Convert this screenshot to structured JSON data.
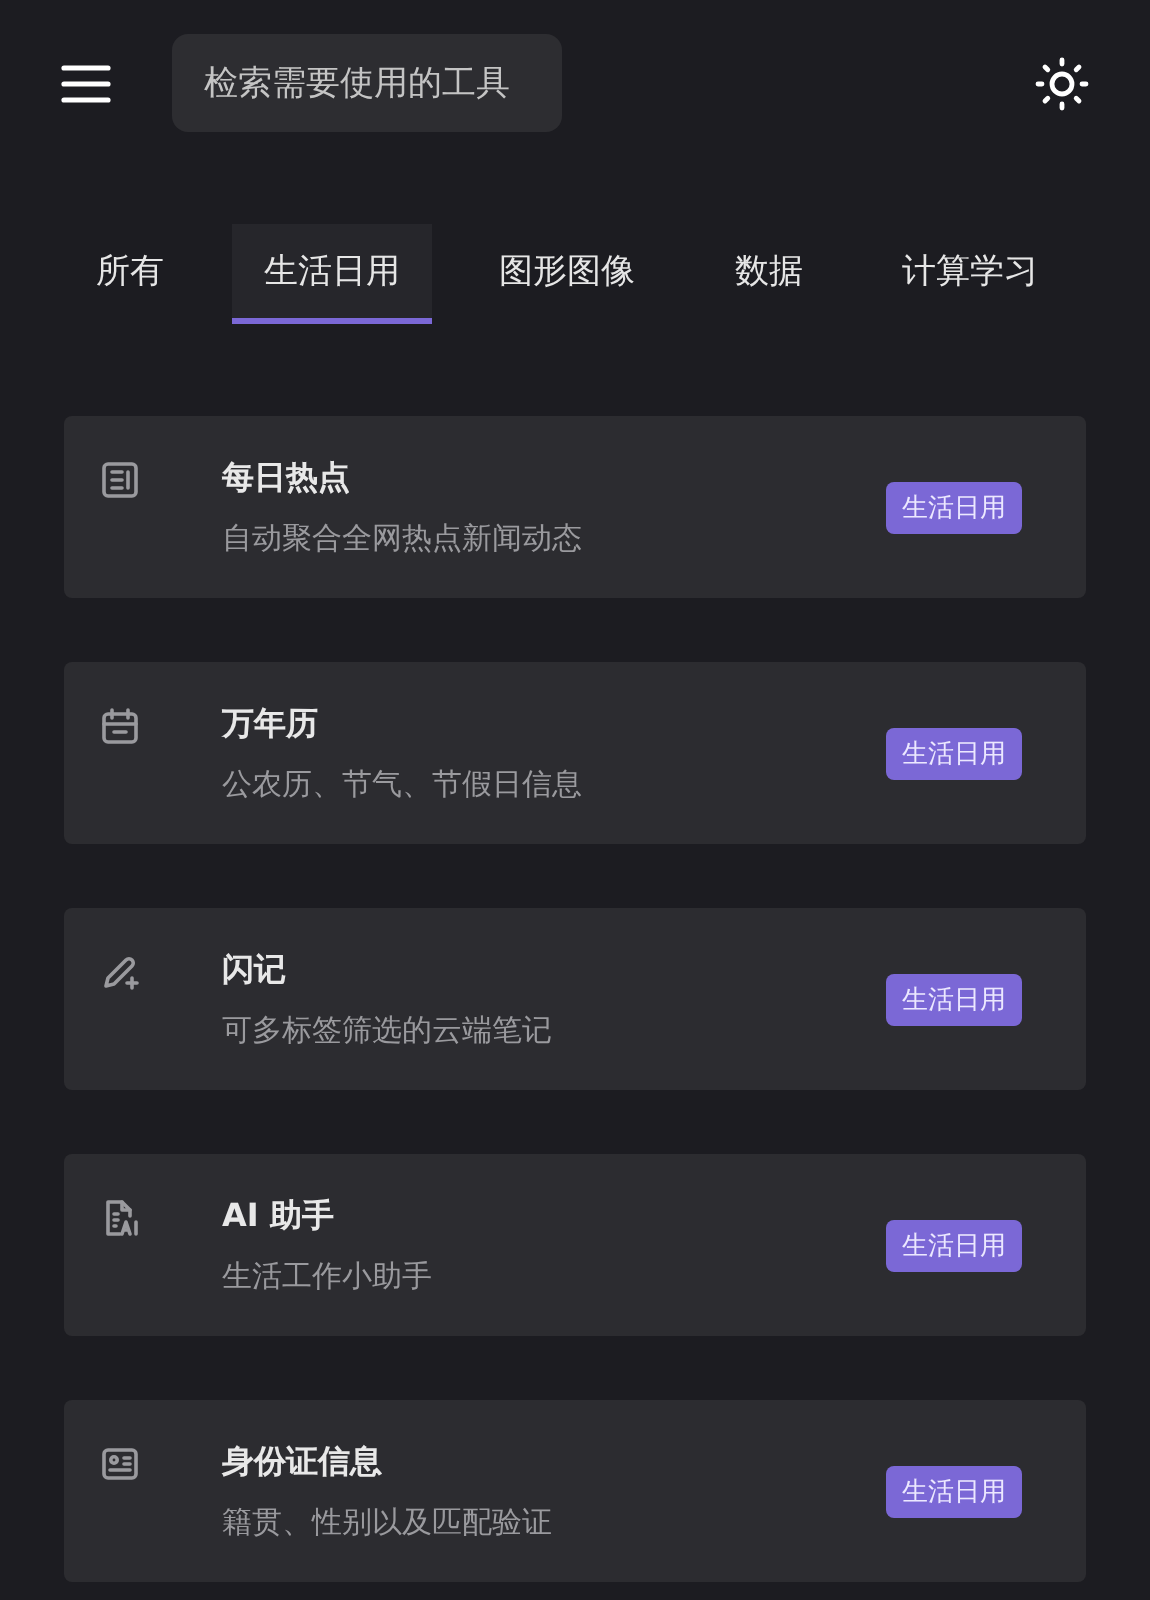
{
  "header": {
    "search": {
      "placeholder": "检索需要使用的工具"
    }
  },
  "tabs": [
    {
      "label": "所有",
      "selected": false
    },
    {
      "label": "生活日用",
      "selected": true
    },
    {
      "label": "图形图像",
      "selected": false
    },
    {
      "label": "数据",
      "selected": false
    },
    {
      "label": "计算学习",
      "selected": false
    }
  ],
  "tools": [
    {
      "kind": "news",
      "title": "每日热点",
      "description": "自动聚合全网热点新闻动态",
      "tag": "生活日用"
    },
    {
      "kind": "calendar",
      "title": "万年历",
      "description": "公农历、节气、节假日信息",
      "tag": "生活日用"
    },
    {
      "kind": "pen",
      "title": "闪记",
      "description": "可多标签筛选的云端笔记",
      "tag": "生活日用"
    },
    {
      "kind": "document",
      "title": "AI 助手",
      "description": "生活工作小助手",
      "tag": "生活日用"
    },
    {
      "kind": "idcard",
      "title": "身份证信息",
      "description": "籍贯、性别以及匹配验证",
      "tag": "生活日用"
    }
  ]
}
